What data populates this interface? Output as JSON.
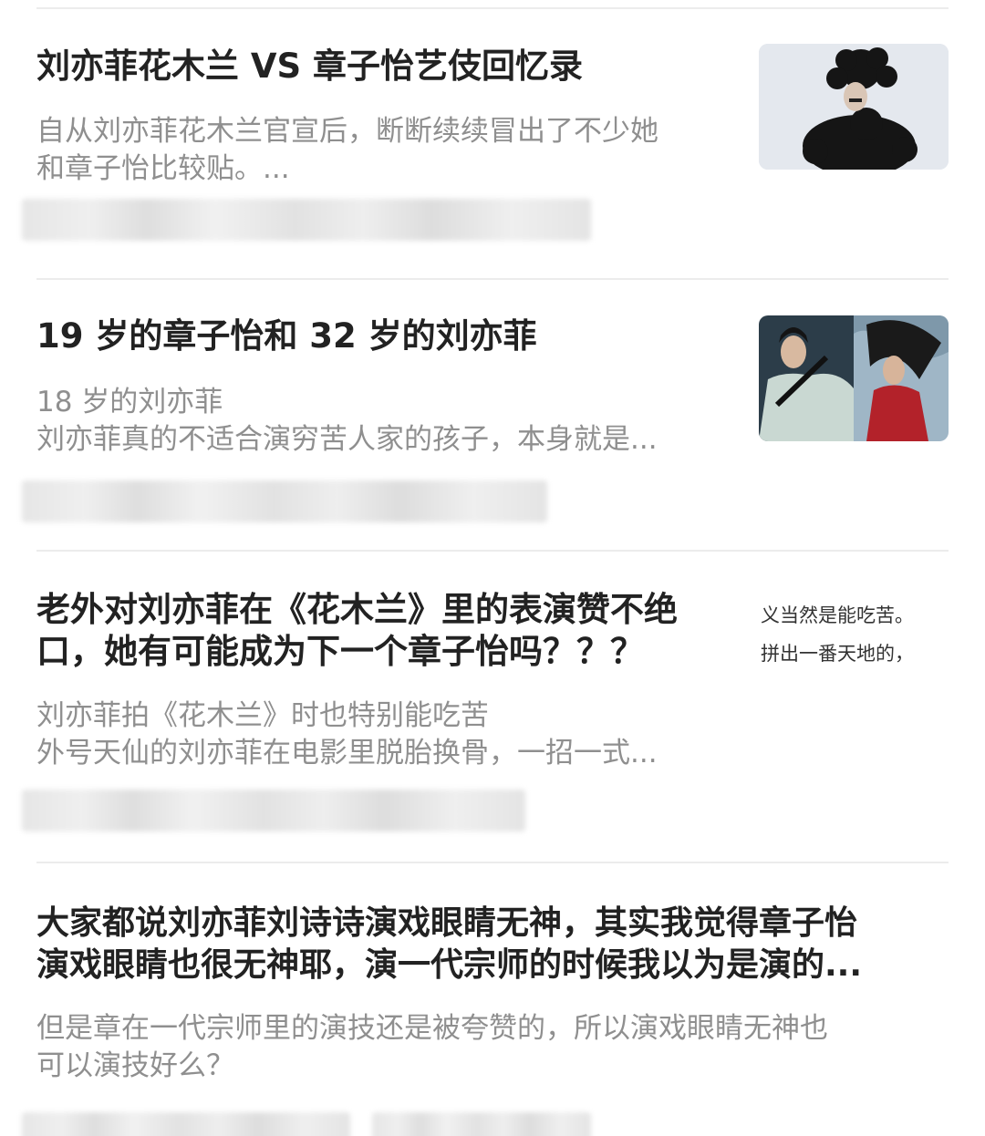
{
  "feed": {
    "items": [
      {
        "title": "刘亦菲花木兰 VS 章子怡艺伎回忆录",
        "summary": [
          "自从刘亦菲花木兰官宣后，断断续续冒出了不少她",
          "和章子怡比较贴。..."
        ],
        "thumbnail": "photo-black-feather-costume"
      },
      {
        "title": "19 岁的章子怡和 32 岁的刘亦菲",
        "summary": [
          "18 岁的刘亦菲",
          "刘亦菲真的不适合演穷苦人家的孩子，本身就是..."
        ],
        "thumbnail": "photo-two-actresses-side-by-side"
      },
      {
        "title": [
          "老外对刘亦菲在《花木兰》里的表演赞不绝",
          "口，她有可能成为下一个章子怡吗？？？"
        ],
        "summary": [
          "刘亦菲拍《花木兰》时也特别能吃苦",
          "外号天仙的刘亦菲在电影里脱胎换骨，一招一式..."
        ],
        "thumbnail_text": [
          "义当然是能吃苦。",
          "拼出一番天地的，"
        ]
      },
      {
        "title": [
          "大家都说刘亦菲刘诗诗演戏眼睛无神，其实我觉得章子怡",
          "演戏眼睛也很无神耶，演一代宗师的时候我以为是演的..."
        ],
        "summary": [
          "但是章在一代宗师里的演技还是被夸赞的，所以演戏眼睛无神也",
          "可以演技好么？"
        ]
      }
    ]
  }
}
